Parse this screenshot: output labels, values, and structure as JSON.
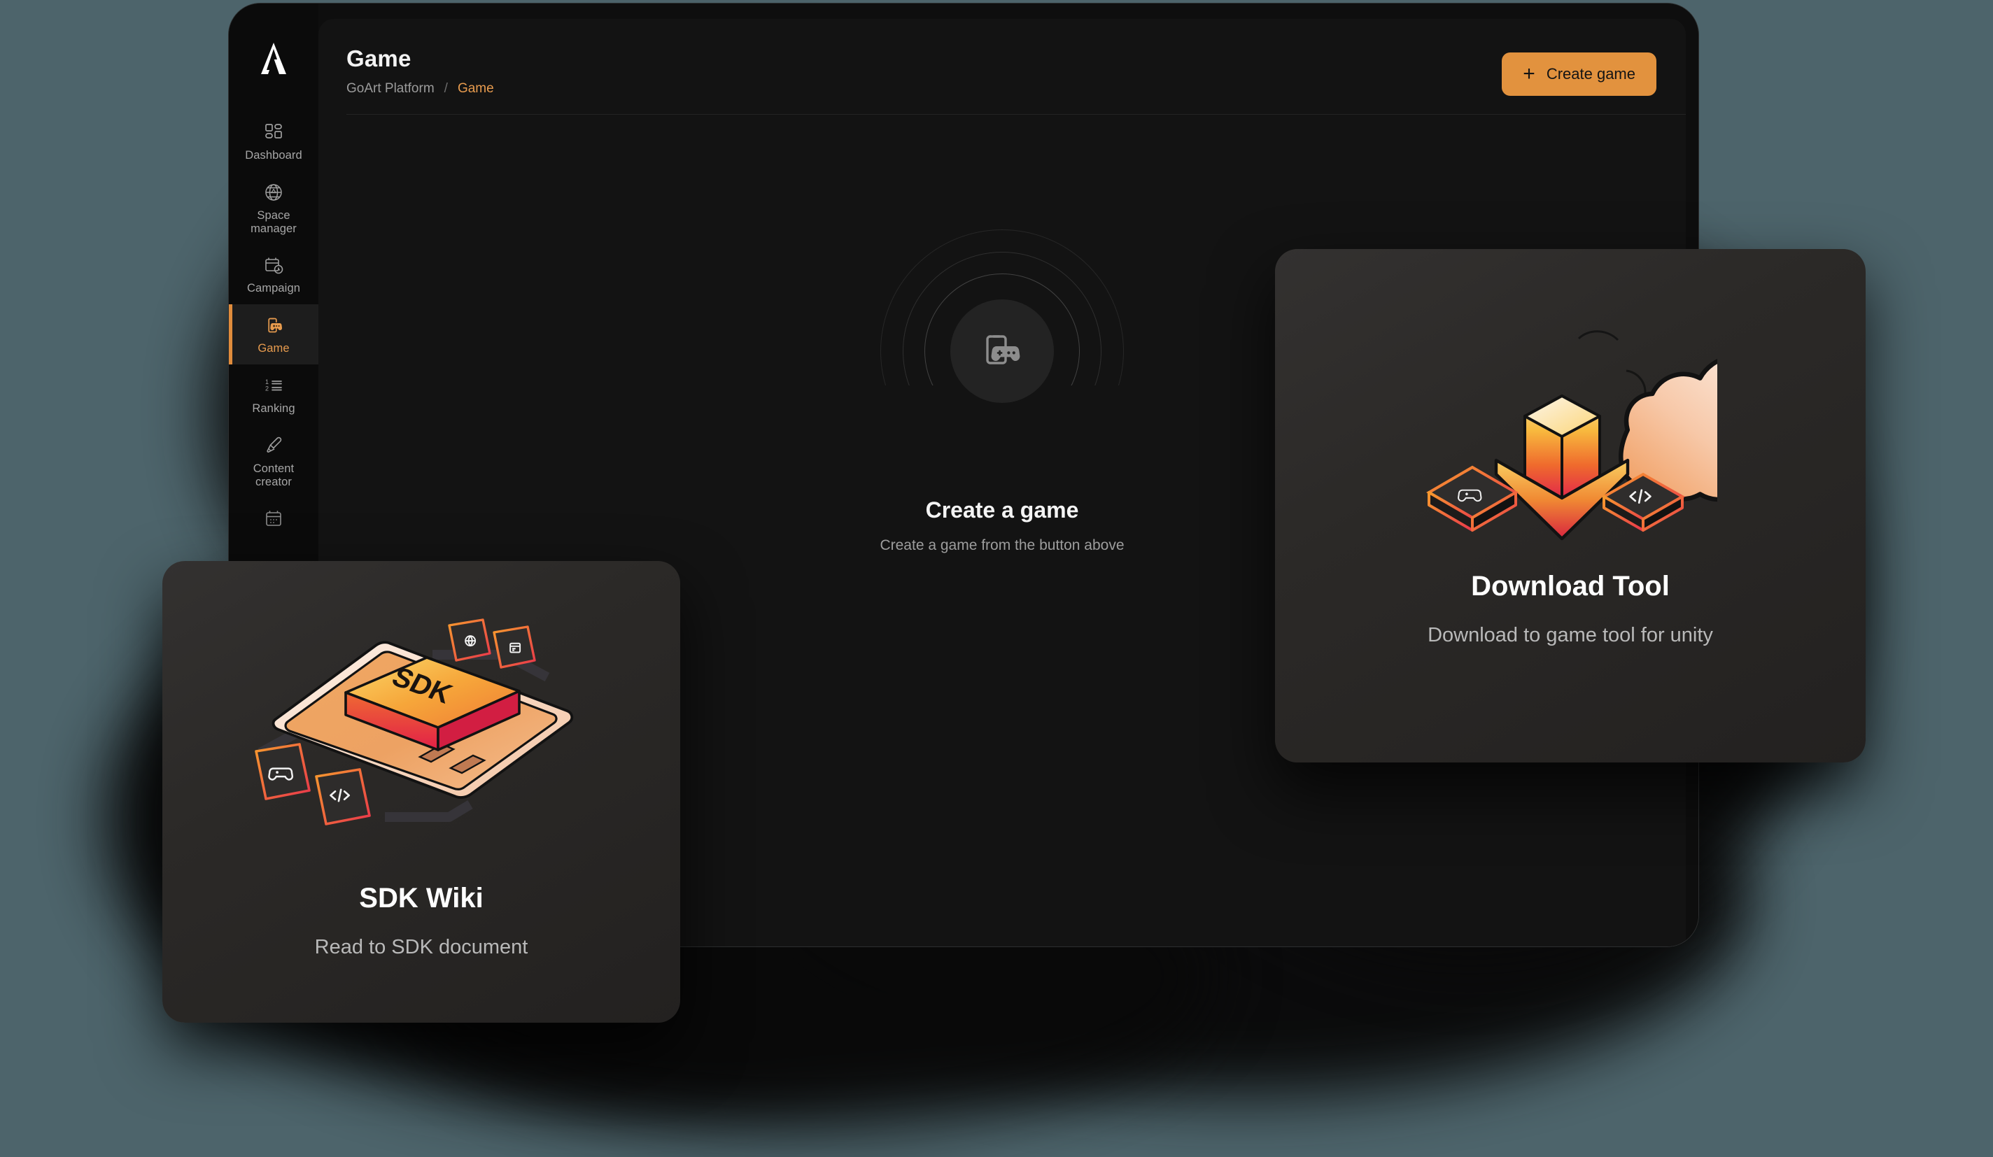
{
  "app": {
    "logo_icon": "goart-logo-icon",
    "background_color": "#4d646b",
    "accent_color": "#e2923e"
  },
  "sidebar": {
    "items": [
      {
        "label": "Dashboard",
        "icon": "dashboard-icon",
        "active": false
      },
      {
        "label": "Space manager",
        "icon": "globe-icon",
        "active": false
      },
      {
        "label": "Campaign",
        "icon": "campaign-clock-icon",
        "active": false
      },
      {
        "label": "Game",
        "icon": "game-controller-icon",
        "active": true
      },
      {
        "label": "Ranking",
        "icon": "ranking-list-icon",
        "active": false
      },
      {
        "label": "Content creator",
        "icon": "paintbrush-icon",
        "active": false
      },
      {
        "label": "",
        "icon": "calendar-icon",
        "active": false
      }
    ]
  },
  "header": {
    "title": "Game",
    "breadcrumb": {
      "root": "GoArt Platform",
      "separator": "/",
      "current": "Game"
    },
    "create_button": {
      "label": "Create game",
      "icon": "plus-icon"
    }
  },
  "empty_state": {
    "icon": "phone-gamepad-icon",
    "title": "Create a game",
    "subtitle": "Create a game from the button above"
  },
  "cards": {
    "download": {
      "title": "Download Tool",
      "subtitle": "Download to game tool for unity",
      "illustration": "cloud-download-isometric-icon"
    },
    "sdk": {
      "title": "SDK Wiki",
      "subtitle": "Read to SDK document",
      "illustration": "tablet-sdk-isometric-icon",
      "block_label": "SDK"
    }
  }
}
